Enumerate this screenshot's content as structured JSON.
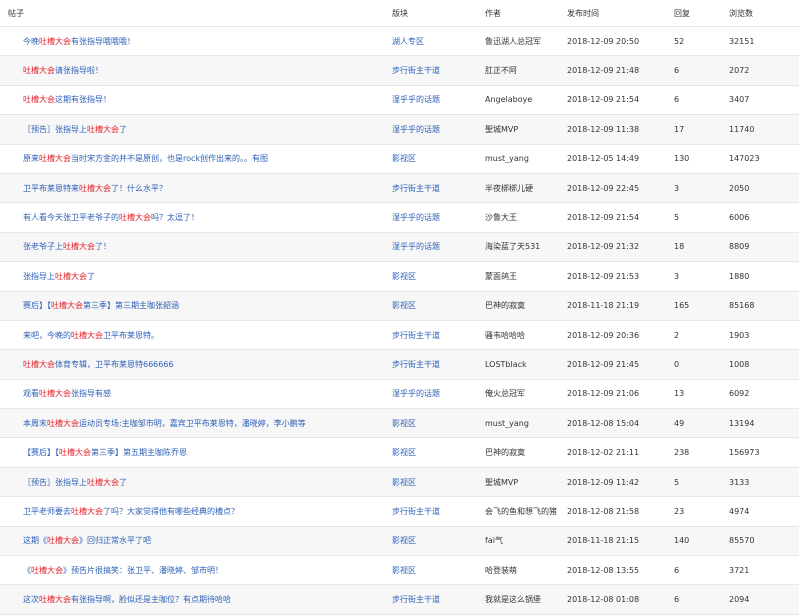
{
  "header": {
    "title": "帖子",
    "board": "版块",
    "author": "作者",
    "time": "发布时间",
    "replies": "回复",
    "views": "浏览数"
  },
  "colors": {
    "link": "#2c5fb8",
    "highlight": "#e0262f",
    "stripe": "#f7f7f7"
  },
  "rows": [
    {
      "pre": "今晚",
      "hl": "吐槽大会",
      "post": "有张指导哦哦哦！",
      "board": "湖人专区",
      "author": "鲁迅湖人总冠军",
      "time": "2018-12-09 20:50",
      "replies": "52",
      "views": "32151"
    },
    {
      "pre": "",
      "hl": "吐槽大会",
      "post": "请张指导啦！",
      "board": "步行街主干道",
      "author": "肛正不阿",
      "time": "2018-12-09 21:48",
      "replies": "6",
      "views": "2072"
    },
    {
      "pre": "",
      "hl": "吐槽大会",
      "post": "这期有张指导！",
      "board": "湿乎乎的话题",
      "author": "Angelaboye",
      "time": "2018-12-09 21:54",
      "replies": "6",
      "views": "3407"
    },
    {
      "pre": "［预告］张指导上",
      "hl": "吐槽大会",
      "post": "了",
      "board": "湿乎乎的话题",
      "author": "聖城MVP",
      "time": "2018-12-09 11:38",
      "replies": "17",
      "views": "11740"
    },
    {
      "pre": "原来",
      "hl": "吐槽大会",
      "post": "当时宋方金的并不是原创，也是rock创作出来的。。有图",
      "board": "影视区",
      "author": "must_yang",
      "time": "2018-12-05 14:49",
      "replies": "130",
      "views": "147023"
    },
    {
      "pre": "卫平布莱恩特来",
      "hl": "吐槽大会",
      "post": "了！什么水平？",
      "board": "步行街主干道",
      "author": "半夜梆梆儿硬",
      "time": "2018-12-09 22:45",
      "replies": "3",
      "views": "2050"
    },
    {
      "pre": "有人看今天张卫平老爷子的",
      "hl": "吐槽大会",
      "post": "吗？太逗了！",
      "board": "湿乎乎的话题",
      "author": "沙鲁大王",
      "time": "2018-12-09 21:54",
      "replies": "5",
      "views": "6006"
    },
    {
      "pre": "张老爷子上",
      "hl": "吐槽大会",
      "post": "了！",
      "board": "湿乎乎的话题",
      "author": "海染蓝了天531",
      "time": "2018-12-09 21:32",
      "replies": "18",
      "views": "8809"
    },
    {
      "pre": "张指导上",
      "hl": "吐槽大会",
      "post": "了",
      "board": "影视区",
      "author": "蒙面鸽王",
      "time": "2018-12-09 21:53",
      "replies": "3",
      "views": "1880"
    },
    {
      "pre": "赛后】【",
      "hl": "吐槽大会",
      "post": "第三季】第三期主咖张韶涵",
      "board": "影视区",
      "author": "巴神的寂寞",
      "time": "2018-11-18 21:19",
      "replies": "165",
      "views": "85168"
    },
    {
      "pre": "来吧，今晚的",
      "hl": "吐槽大会",
      "post": "卫平布莱恩特。",
      "board": "步行街主干道",
      "author": "骚韦哈哈哈",
      "time": "2018-12-09 20:36",
      "replies": "2",
      "views": "1903"
    },
    {
      "pre": "",
      "hl": "吐槽大会",
      "post": "体育专辑，卫平布莱恩特666666",
      "board": "步行街主干道",
      "author": "LOSTblack",
      "time": "2018-12-09 21:45",
      "replies": "0",
      "views": "1008"
    },
    {
      "pre": "观看",
      "hl": "吐槽大会",
      "post": "张指导有感",
      "board": "湿乎乎的话题",
      "author": "俺火总冠军",
      "time": "2018-12-09 21:06",
      "replies": "13",
      "views": "6092"
    },
    {
      "pre": "本周末",
      "hl": "吐槽大会",
      "post": "运动员专场:主咖邹市明，嘉宾卫平布莱恩特，潘晓婷，李小鹏等",
      "board": "影视区",
      "author": "must_yang",
      "time": "2018-12-08 15:04",
      "replies": "49",
      "views": "13194"
    },
    {
      "pre": "【赛后】【",
      "hl": "吐槽大会",
      "post": "第三季】第五期主咖陈乔恩",
      "board": "影视区",
      "author": "巴神的寂寞",
      "time": "2018-12-02 21:11",
      "replies": "238",
      "views": "156973"
    },
    {
      "pre": "［预告］张指导上",
      "hl": "吐槽大会",
      "post": "了",
      "board": "影视区",
      "author": "聖城MVP",
      "time": "2018-12-09 11:42",
      "replies": "5",
      "views": "3133"
    },
    {
      "pre": "卫平老师要去",
      "hl": "吐槽大会",
      "post": "了吗？大家觉得他有哪些经典的槽点？",
      "board": "步行街主干道",
      "author": "会飞的鱼和想飞的猪",
      "time": "2018-12-08 21:58",
      "replies": "23",
      "views": "4974"
    },
    {
      "pre": "这期《",
      "hl": "吐槽大会",
      "post": "》回归正常水平了吧",
      "board": "影视区",
      "author": "fai气",
      "time": "2018-11-18 21:15",
      "replies": "140",
      "views": "85570"
    },
    {
      "pre": "《",
      "hl": "吐槽大会",
      "post": "》预告片很搞笑：张卫平、潘晓婷、邹市明！",
      "board": "影视区",
      "author": "哈登装萌",
      "time": "2018-12-08 13:55",
      "replies": "6",
      "views": "3721"
    },
    {
      "pre": "这次",
      "hl": "吐槽大会",
      "post": "有张指导啊，脸似还是主咖位？有点期待哈哈",
      "board": "步行街主干道",
      "author": "我就是这么锅堡",
      "time": "2018-12-08 01:08",
      "replies": "6",
      "views": "2094"
    }
  ]
}
